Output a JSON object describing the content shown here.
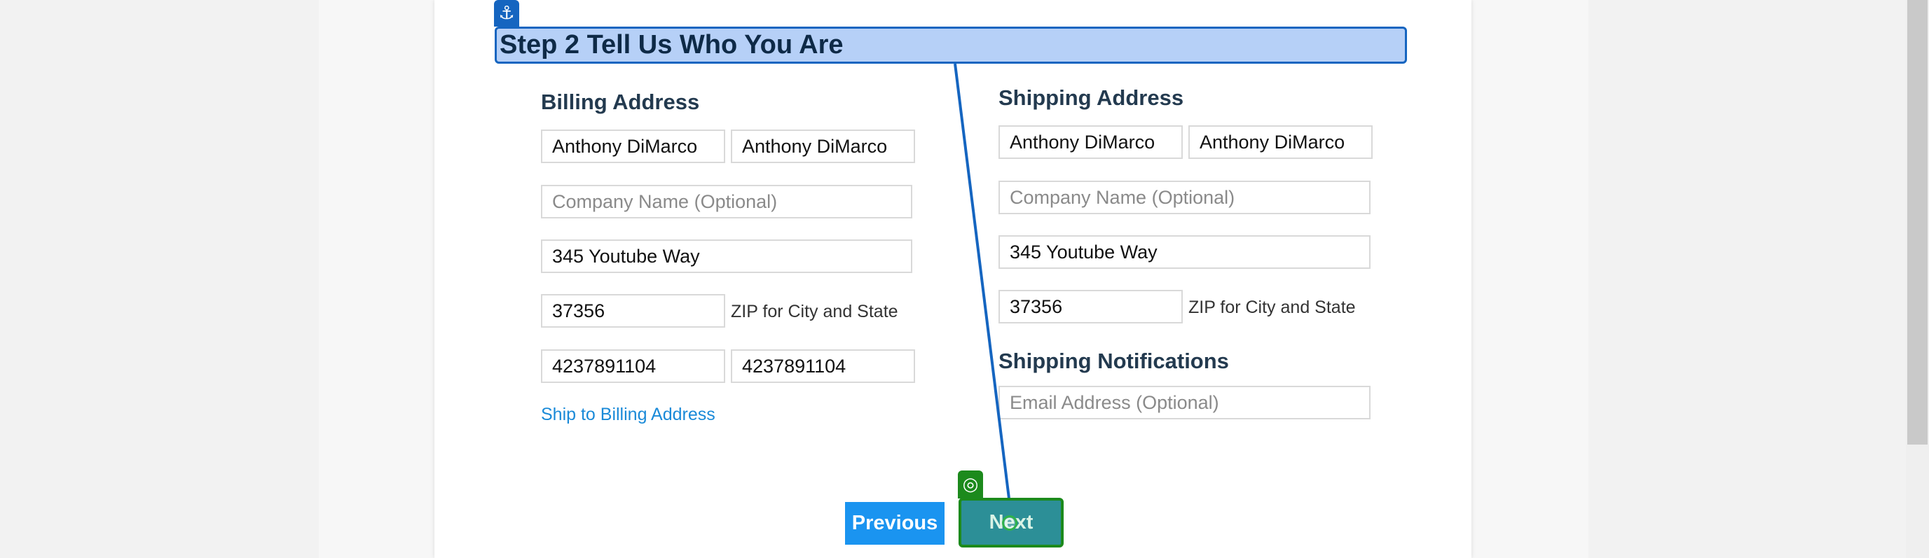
{
  "step": {
    "title": "Step 2 Tell Us Who You Are"
  },
  "billing": {
    "heading": "Billing Address",
    "first_name": "Anthony DiMarco",
    "last_name": "Anthony DiMarco",
    "company_placeholder": "Company Name (Optional)",
    "company_value": "",
    "street": "345 Youtube Way",
    "zip": "37356",
    "zip_hint": "ZIP for City and State",
    "phone_1": "4237891104",
    "phone_2": "4237891104",
    "ship_to_billing_link": "Ship to Billing Address"
  },
  "shipping": {
    "heading": "Shipping Address",
    "first_name": "Anthony DiMarco",
    "last_name": "Anthony DiMarco",
    "company_placeholder": "Company Name (Optional)",
    "company_value": "",
    "street": "345 Youtube Way",
    "zip": "37356",
    "zip_hint": "ZIP for City and State"
  },
  "notifications": {
    "heading": "Shipping Notifications",
    "email_placeholder": "Email Address (Optional)",
    "email_value": ""
  },
  "actions": {
    "previous_label": "Previous",
    "next_label": "Next"
  },
  "annotations": {
    "anchor_icon": "anchor-icon",
    "target_icon": "target-icon",
    "anchor_color": "#1565c0",
    "target_color": "#1c8a1c"
  }
}
